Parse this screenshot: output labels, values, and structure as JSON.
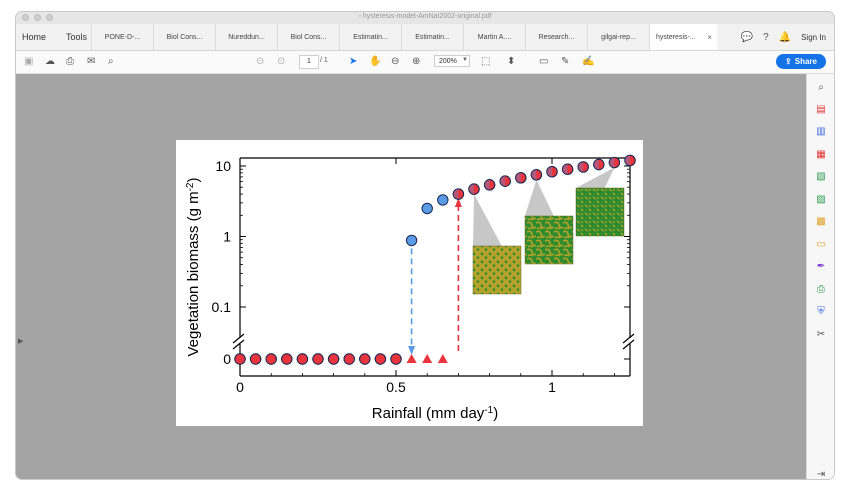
{
  "window": {
    "doc_title": "hysteresis-model-AmNat2002-original.pdf"
  },
  "nav": {
    "home": "Home",
    "tools": "Tools"
  },
  "tabs": [
    {
      "label": "PONE-D-..."
    },
    {
      "label": "Biol Cons..."
    },
    {
      "label": "Nureddun..."
    },
    {
      "label": "Biol Cons..."
    },
    {
      "label": "Estimatin..."
    },
    {
      "label": "Estimatin..."
    },
    {
      "label": "Martin A...."
    },
    {
      "label": "Research..."
    },
    {
      "label": "gilgai-rep..."
    },
    {
      "label": "hysteresis-...",
      "close": "×"
    }
  ],
  "header_right": {
    "sign_in": "Sign In"
  },
  "toolbar": {
    "page_current": "1",
    "page_total": "/ 1",
    "zoom": "200%",
    "share": "Share"
  },
  "chart_data": {
    "type": "scatter",
    "xlabel": "Rainfall (mm day",
    "xlabel_sup": "-1",
    "xlabel_end": ")",
    "ylabel": "Vegetation biomass (g m",
    "ylabel_sup": "-2",
    "ylabel_end": ")",
    "yscale": "log with broken axis at 0",
    "xlim": [
      0,
      1.25
    ],
    "x_ticks": [
      "0",
      "0.5",
      "1"
    ],
    "y_ticks": [
      "0",
      "0.1",
      "1",
      "10"
    ],
    "series": [
      {
        "marker": "circle-blue",
        "color": "#5b9be6",
        "x": [
          0,
          0.05,
          0.1,
          0.15,
          0.2,
          0.25,
          0.3,
          0.35,
          0.4,
          0.45,
          0.5,
          0.55,
          0.6,
          0.65,
          0.7,
          0.75,
          0.8,
          0.85,
          0.9,
          0.95,
          1.0,
          1.05,
          1.1,
          1.15,
          1.2,
          1.25
        ],
        "y": [
          0,
          0,
          0,
          0,
          0,
          0,
          0,
          0,
          0,
          0,
          0,
          0.88,
          2.5,
          3.3,
          4.0,
          4.7,
          5.4,
          6.1,
          6.8,
          7.5,
          8.3,
          9.0,
          9.7,
          10.5,
          11.2,
          12.0
        ]
      },
      {
        "marker": "circle-red",
        "color": "#e8343c",
        "x": [
          0,
          0.05,
          0.1,
          0.15,
          0.2,
          0.25,
          0.3,
          0.35,
          0.4,
          0.45,
          0.5,
          0.7,
          0.75,
          0.8,
          0.85,
          0.9,
          0.95,
          1.0,
          1.05,
          1.1,
          1.15,
          1.2,
          1.25
        ],
        "y": [
          0,
          0,
          0,
          0,
          0,
          0,
          0,
          0,
          0,
          0,
          0,
          4.0,
          4.7,
          5.4,
          6.1,
          6.8,
          7.5,
          8.3,
          9.0,
          9.7,
          10.5,
          11.2,
          12.0
        ]
      },
      {
        "marker": "triangle-red",
        "color": "#e8343c",
        "x": [
          0.55,
          0.6,
          0.65
        ],
        "y": [
          0,
          0,
          0
        ]
      }
    ],
    "annotations": [
      {
        "type": "arrow-down-dashed",
        "color": "#5b9be6",
        "x": 0.55,
        "from_y": 0.88,
        "to_y": 0
      },
      {
        "type": "arrow-up-dashed",
        "color": "#e8343c",
        "x": 0.7,
        "from_y": 0,
        "to_y": 4.0
      }
    ],
    "insets": [
      {
        "pattern": "spots",
        "points_to_x": 0.75
      },
      {
        "pattern": "labyrinth",
        "points_to_x": 0.95
      },
      {
        "pattern": "gaps",
        "points_to_x": 1.2
      }
    ]
  },
  "colors": {
    "accent": "#1473e6",
    "vegetation": "#2e8b2e",
    "soil": "#b5a22a"
  }
}
